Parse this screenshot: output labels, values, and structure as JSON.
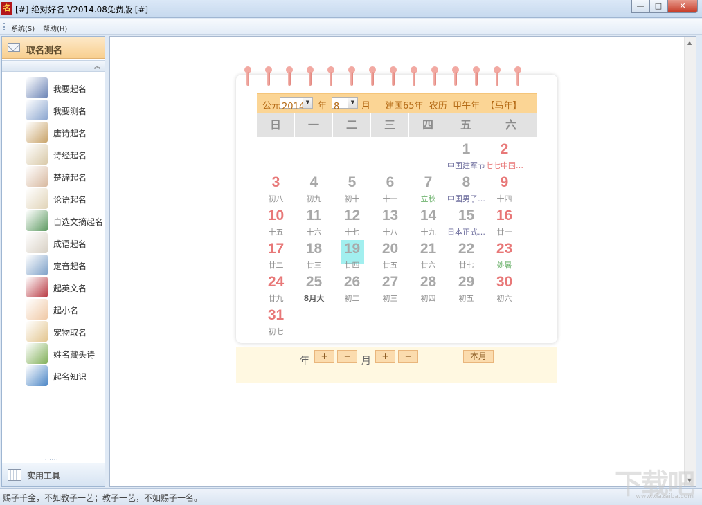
{
  "window": {
    "title": "[#] 绝对好名 V2014.08免费版 [#]",
    "icon": "app-logo-icon",
    "icon_glyph": "名",
    "minimize": "—",
    "maximize": "□",
    "close": "✕"
  },
  "menu": [
    {
      "label": "系统(S)"
    },
    {
      "label": "帮助(H)"
    }
  ],
  "sidebar": {
    "header": "取名测名",
    "collapse_glyph": "︽",
    "items": [
      {
        "label": "我要起名",
        "icon": "person-icon"
      },
      {
        "label": "我要测名",
        "icon": "magnifier-icon"
      },
      {
        "label": "唐诗起名",
        "icon": "tang-poem-icon"
      },
      {
        "label": "诗经起名",
        "icon": "shijing-book-icon"
      },
      {
        "label": "楚辞起名",
        "icon": "chuci-book-icon"
      },
      {
        "label": "论语起名",
        "icon": "lunyu-book-icon"
      },
      {
        "label": "自选文摘起名",
        "icon": "books-icon"
      },
      {
        "label": "成语起名",
        "icon": "idiom-scroll-icon"
      },
      {
        "label": "定音起名",
        "icon": "speaker-icon"
      },
      {
        "label": "起英文名",
        "icon": "uk-flag-icon"
      },
      {
        "label": "起小名",
        "icon": "baby-icon"
      },
      {
        "label": "宠物取名",
        "icon": "dog-icon"
      },
      {
        "label": "姓名藏头诗",
        "icon": "poem-badge-icon"
      },
      {
        "label": "起名知识",
        "icon": "globe-icon"
      }
    ],
    "footer": "实用工具",
    "footer_grip": "······"
  },
  "calendar": {
    "era_label": "公元",
    "year_value": "2014",
    "year_label": "年",
    "month_value": "8",
    "month_label": "月",
    "info": "建国65年  农历  甲午年  【马年】",
    "weekdays": [
      "日",
      "一",
      "二",
      "三",
      "四",
      "五",
      "六"
    ],
    "today": "19",
    "days": [
      {
        "d": "1",
        "sub": "中国建军节"
      },
      {
        "d": "2",
        "sub": "七七中国…"
      },
      {
        "d": "3",
        "sub": "初八"
      },
      {
        "d": "4",
        "sub": "初九"
      },
      {
        "d": "5",
        "sub": "初十"
      },
      {
        "d": "6",
        "sub": "十一"
      },
      {
        "d": "7",
        "sub": "立秋"
      },
      {
        "d": "8",
        "sub": "中国男子…"
      },
      {
        "d": "9",
        "sub": "十四"
      },
      {
        "d": "10",
        "sub": "十五"
      },
      {
        "d": "11",
        "sub": "十六"
      },
      {
        "d": "12",
        "sub": "十七"
      },
      {
        "d": "13",
        "sub": "十八"
      },
      {
        "d": "14",
        "sub": "十九"
      },
      {
        "d": "15",
        "sub": "日本正式…"
      },
      {
        "d": "16",
        "sub": "廿一"
      },
      {
        "d": "17",
        "sub": "廿二"
      },
      {
        "d": "18",
        "sub": "廿三"
      },
      {
        "d": "19",
        "sub": "廿四"
      },
      {
        "d": "20",
        "sub": "廿五"
      },
      {
        "d": "21",
        "sub": "廿六"
      },
      {
        "d": "22",
        "sub": "廿七"
      },
      {
        "d": "23",
        "sub": "处暑"
      },
      {
        "d": "24",
        "sub": "廿九"
      },
      {
        "d": "25",
        "sub": "8月大"
      },
      {
        "d": "26",
        "sub": "初二"
      },
      {
        "d": "27",
        "sub": "初三"
      },
      {
        "d": "28",
        "sub": "初四"
      },
      {
        "d": "29",
        "sub": "初五"
      },
      {
        "d": "30",
        "sub": "初六"
      },
      {
        "d": "31",
        "sub": "初七"
      }
    ],
    "footer": {
      "year_label": "年",
      "plus": "+",
      "minus": "−",
      "month_label": "月",
      "current_month": "本月"
    }
  },
  "status": {
    "text": "赐子千金，不如教子一艺；教子一艺，不如赐子一名。"
  },
  "watermark": {
    "text": "下载吧",
    "url": "www.xiazaiba.com"
  },
  "colors": {
    "accent_orange": "#fbd595",
    "weekend_red": "#e87878",
    "today_highlight": "#a2efef",
    "solar_term_green": "#72b572"
  }
}
